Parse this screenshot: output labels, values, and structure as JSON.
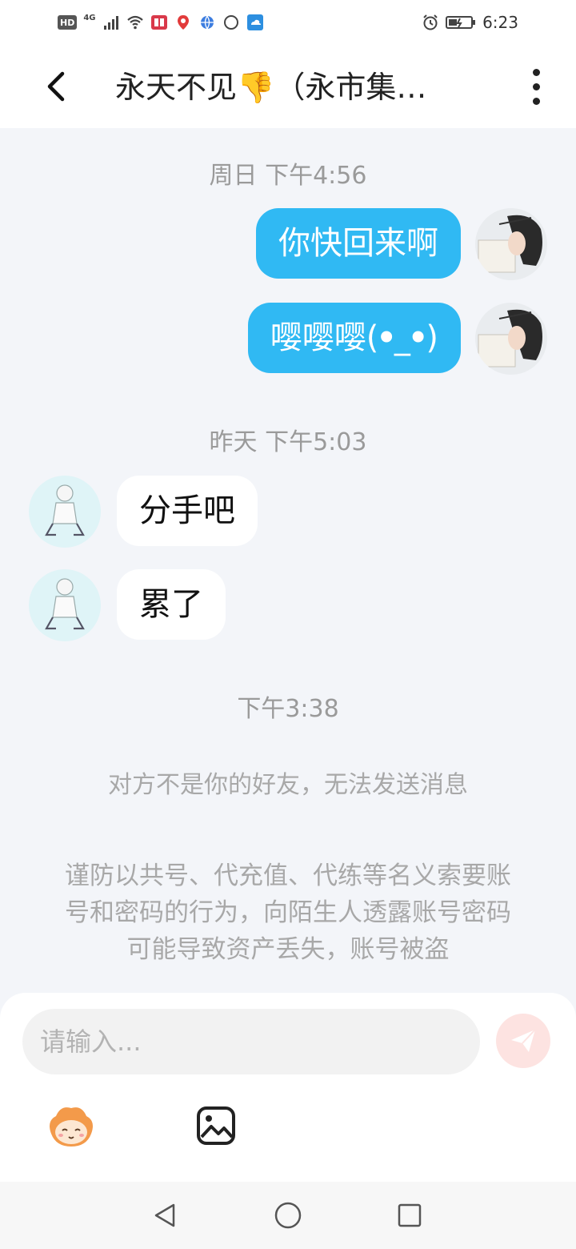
{
  "status_bar": {
    "hd": "HD",
    "network": "4G",
    "time": "6:23",
    "icons": [
      "hd-icon",
      "signal-icon",
      "wifi-icon",
      "news-app-icon",
      "map-app-icon",
      "browser-icon",
      "ring-icon",
      "weather-icon",
      "alarm-icon",
      "battery-icon"
    ]
  },
  "header": {
    "title": "永天不见👎（永市集…",
    "back_icon": "chevron-left-icon",
    "more_icon": "more-vertical-icon"
  },
  "chat": {
    "groups": [
      {
        "timestamp": "周日  下午4:56",
        "messages": [
          {
            "direction": "out",
            "text": "你快回来啊"
          },
          {
            "direction": "out",
            "text": "嘤嘤嘤(ꔷ_ꔷ)"
          }
        ]
      },
      {
        "timestamp": "昨天  下午5:03",
        "messages": [
          {
            "direction": "in",
            "text": "分手吧"
          },
          {
            "direction": "in",
            "text": "累了"
          }
        ]
      },
      {
        "timestamp": "下午3:38",
        "messages": []
      }
    ],
    "system_notice": "对方不是你的好友，无法发送消息",
    "security_warning": "谨防以共号、代充值、代练等名义索要账号和密码的行为，向陌生人透露账号密码可能导致资产丢失，账号被盗"
  },
  "composer": {
    "placeholder": "请输入...",
    "value": "",
    "send_icon": "send-icon",
    "emoji_icon": "sticker-face-icon",
    "image_icon": "image-icon"
  },
  "nav": {
    "back_icon": "triangle-back-icon",
    "home_icon": "circle-home-icon",
    "recent_icon": "square-recents-icon"
  },
  "colors": {
    "outgoing_bubble": "#30b9f3",
    "incoming_bubble": "#ffffff",
    "chat_background": "#f3f5f9",
    "send_button": "#fde3e1"
  }
}
